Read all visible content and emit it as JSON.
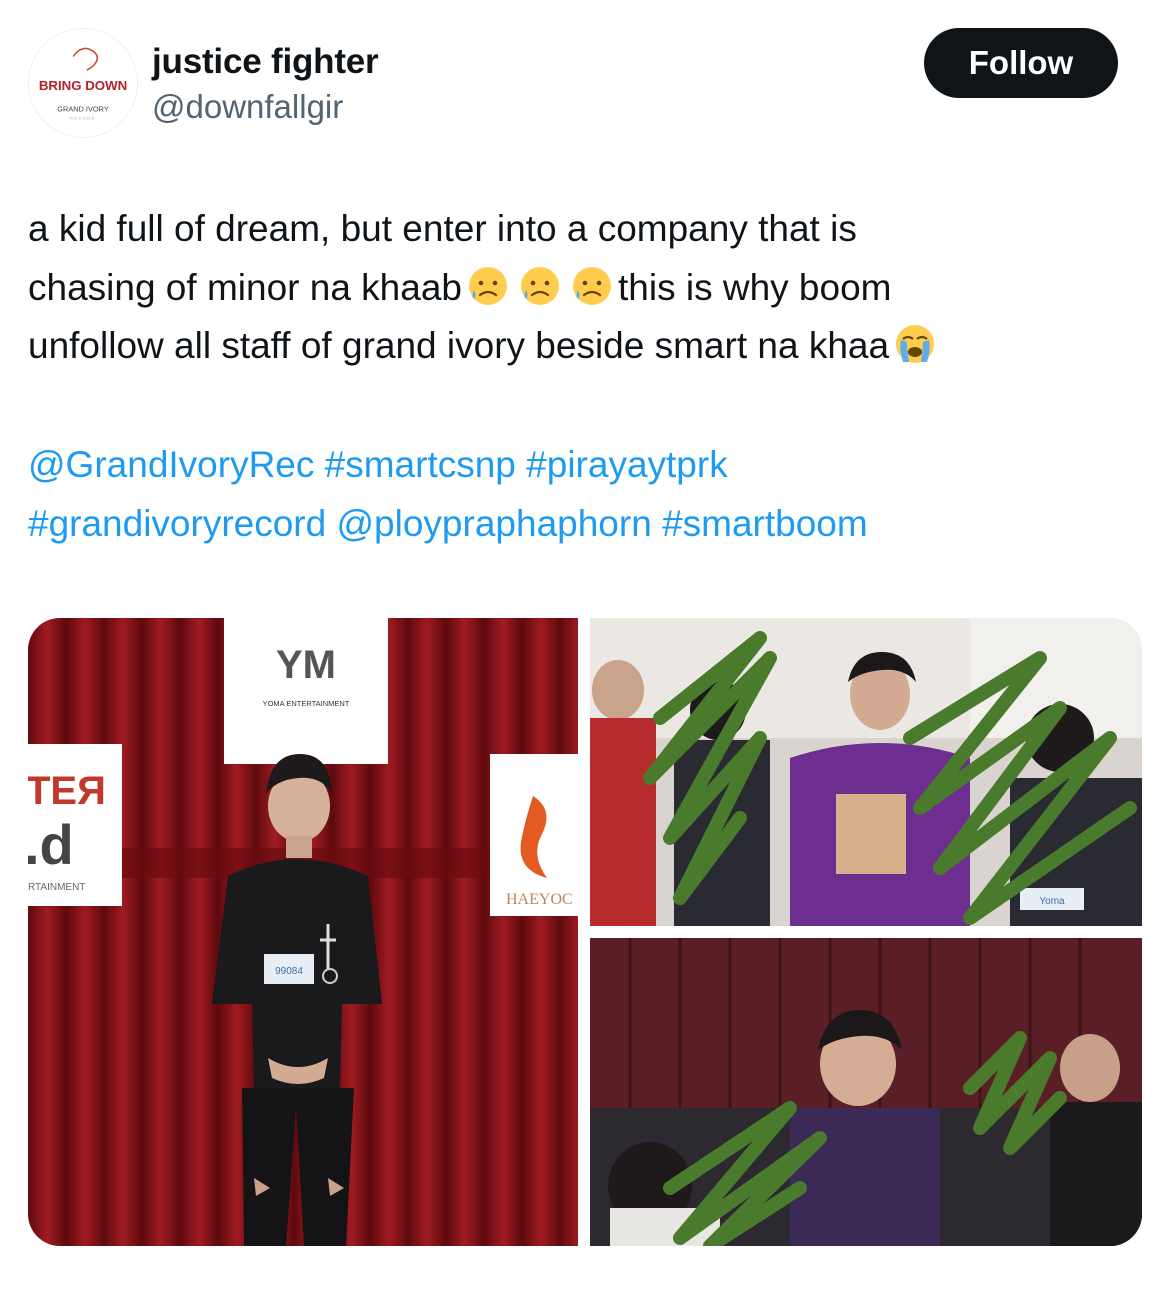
{
  "author": {
    "display_name": "justice fighter",
    "handle": "@downfallgir",
    "avatar_logo": {
      "top_text": "BRING DOWN",
      "bottom_text": "GRAND IVORY",
      "sub_text": "RECORD"
    }
  },
  "follow_button": {
    "label": "Follow"
  },
  "tweet": {
    "line1": "a kid full of dream, but enter into a company that is",
    "line2_a": "chasing of minor na khaab",
    "line2_b": "this is why boom",
    "line3": "unfollow all staff of grand ivory beside smart na khaa",
    "emojis": [
      "sad-tear-face-emoji",
      "sad-tear-face-emoji",
      "sad-tear-face-emoji",
      "loudly-crying-face-emoji"
    ]
  },
  "tags": {
    "mention_1": "@GrandIvoryRec",
    "hashtag_1": "#smartcsnp",
    "hashtag_2": "#pirayaytprk",
    "hashtag_3": "#grandivoryrecord",
    "mention_2": "@ploypraphaphorn",
    "hashtag_4": "#smartboom"
  },
  "media": {
    "photo_1": {
      "sign_center_logo": "YM",
      "sign_center_text": "YOMA ENTERTAINMENT",
      "sign_left_text_1": "TEЯ",
      "sign_left_text_2": ".d",
      "sign_left_text_3": "RTAINMENT",
      "sign_right_text": "HAEYOC",
      "badge_text": "99084"
    },
    "photo_2": {
      "badge_text": "Yoma"
    },
    "photo_3": {}
  },
  "colors": {
    "link": "#1d9bf0",
    "text": "#0f1419",
    "secondary": "#536471",
    "button_bg": "#0f1419",
    "scribble": "#4a7a2c",
    "curtain": "#8a1419"
  }
}
